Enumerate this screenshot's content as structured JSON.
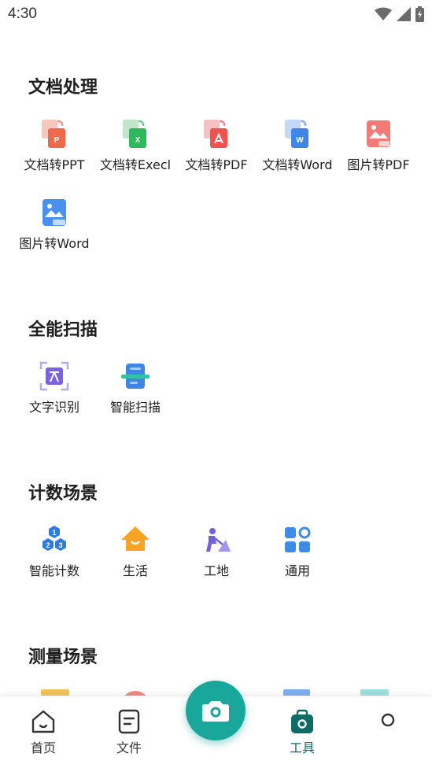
{
  "status_bar": {
    "time": "4:30"
  },
  "sections": {
    "doc": {
      "title": "文档处理",
      "items": [
        {
          "label": "文档转PPT",
          "icon": "ppt-convert-icon"
        },
        {
          "label": "文档转Execl",
          "icon": "excel-convert-icon"
        },
        {
          "label": "文档转PDF",
          "icon": "pdf-convert-icon"
        },
        {
          "label": "文档转Word",
          "icon": "word-convert-icon"
        },
        {
          "label": "图片转PDF",
          "icon": "image-to-pdf-icon"
        },
        {
          "label": "图片转Word",
          "icon": "image-to-word-icon"
        }
      ]
    },
    "scan": {
      "title": "全能扫描",
      "items": [
        {
          "label": "文字识别",
          "icon": "text-recognition-icon"
        },
        {
          "label": "智能扫描",
          "icon": "smart-scan-icon"
        }
      ]
    },
    "count": {
      "title": "计数场景",
      "items": [
        {
          "label": "智能计数",
          "icon": "smart-count-icon"
        },
        {
          "label": "生活",
          "icon": "life-icon"
        },
        {
          "label": "工地",
          "icon": "construction-icon"
        },
        {
          "label": "通用",
          "icon": "general-icon"
        }
      ]
    },
    "measure": {
      "title": "测量场景"
    }
  },
  "nav": {
    "home": "首页",
    "files": "文件",
    "tools": "工具"
  },
  "colors": {
    "accent": "#1aa79b",
    "nav_active": "#0e6b66"
  }
}
